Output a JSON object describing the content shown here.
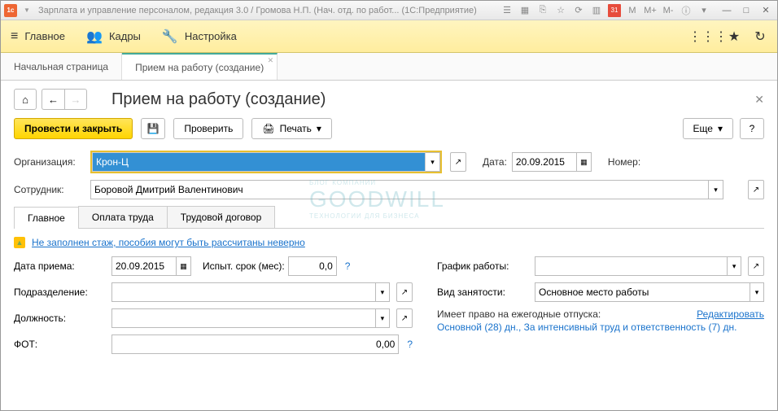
{
  "titlebar": {
    "text": "Зарплата и управление персоналом, редакция 3.0 / Громова Н.П. (Нач. отд. по работ... (1С:Предприятие)",
    "m_icons": [
      "M",
      "M+",
      "M-"
    ]
  },
  "topbar": {
    "items": [
      {
        "icon": "≡",
        "label": "Главное"
      },
      {
        "icon": "👥",
        "label": "Кадры"
      },
      {
        "icon": "🔧",
        "label": "Настройка"
      }
    ]
  },
  "tabs": [
    {
      "label": "Начальная страница",
      "active": false
    },
    {
      "label": "Прием на работу (создание)",
      "active": true
    }
  ],
  "page": {
    "title": "Прием на работу (создание)"
  },
  "toolbar": {
    "submit": "Провести и закрыть",
    "check": "Проверить",
    "print": "Печать",
    "more": "Еще"
  },
  "form": {
    "org_label": "Организация:",
    "org_value": "Крон-Ц",
    "date_label": "Дата:",
    "date_value": "20.09.2015",
    "number_label": "Номер:",
    "number_value": "",
    "employee_label": "Сотрудник:",
    "employee_value": "Боровой Дмитрий Валентинович"
  },
  "inner_tabs": [
    "Главное",
    "Оплата труда",
    "Трудовой договор"
  ],
  "warning": "Не заполнен стаж, пособия могут быть рассчитаны неверно",
  "fields": {
    "hire_date_label": "Дата приема:",
    "hire_date_value": "20.09.2015",
    "probation_label": "Испыт. срок (мес):",
    "probation_value": "0,0",
    "department_label": "Подразделение:",
    "department_value": "",
    "position_label": "Должность:",
    "position_value": "",
    "fot_label": "ФОТ:",
    "fot_value": "0,00",
    "schedule_label": "График работы:",
    "schedule_value": "",
    "employment_label": "Вид занятости:",
    "employment_value": "Основное место работы",
    "vacation_label": "Имеет право на ежегодные отпуска:",
    "vacation_text": "Основной (28) дн., За интенсивный труд и ответственность (7) дн.",
    "edit": "Редактировать"
  },
  "watermark": {
    "main": "GOODWILL",
    "sub": "ТЕХНОЛОГИИ ДЛЯ БИЗНЕСА",
    "top": "БЛОГ КОМПАНИИ"
  }
}
